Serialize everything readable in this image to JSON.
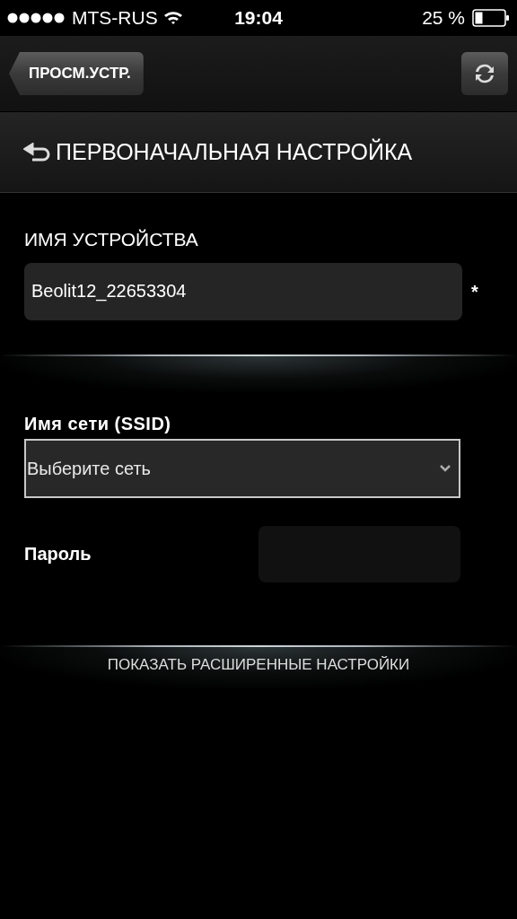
{
  "status_bar": {
    "carrier": "MTS-RUS",
    "time": "19:04",
    "battery": "25 %"
  },
  "nav_bar": {
    "back_button": "ПРОСМ.УСТР."
  },
  "section": {
    "title": "ПЕРВОНАЧАЛЬНАЯ НАСТРОЙКА"
  },
  "device_name": {
    "label": "ИМЯ УСТРОЙСТВА",
    "value": "Beolit12_22653304",
    "required_mark": "*"
  },
  "network": {
    "label": "Имя сети (SSID)",
    "value": "Выберите сеть"
  },
  "password": {
    "label": "Пароль"
  },
  "advanced_link": "ПОКАЗАТЬ РАСШИРЕННЫЕ НАСТРОЙКИ"
}
